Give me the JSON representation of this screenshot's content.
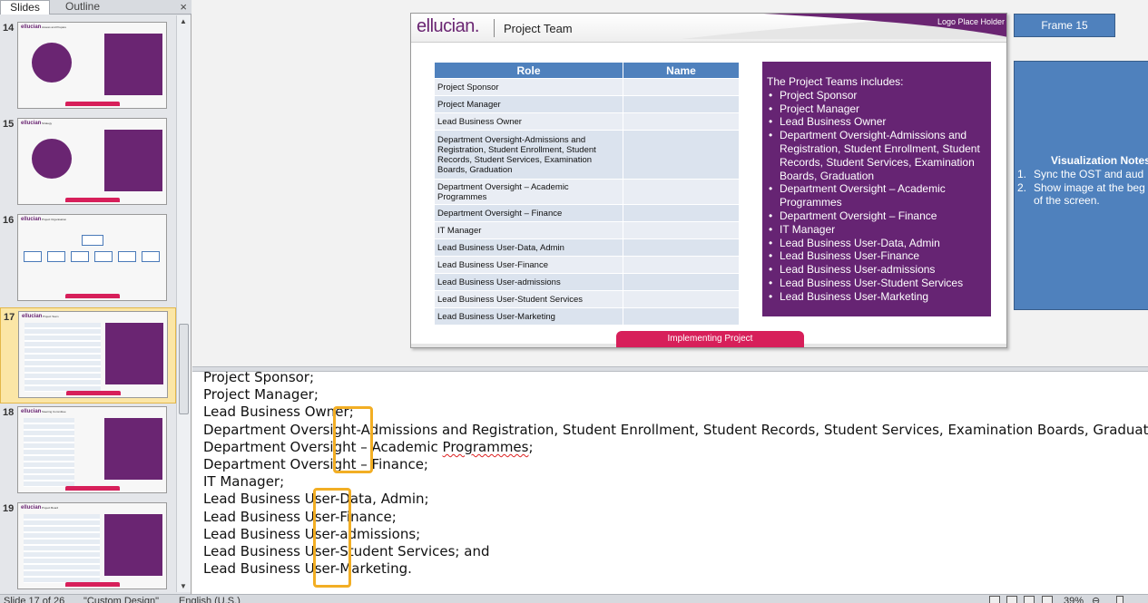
{
  "pane": {
    "tab_slides": "Slides",
    "tab_outline": "Outline",
    "close": "×"
  },
  "thumbnails": [
    {
      "num": "14",
      "kind": "circle",
      "selected": false
    },
    {
      "num": "15",
      "kind": "circle",
      "selected": false
    },
    {
      "num": "16",
      "kind": "org",
      "selected": false
    },
    {
      "num": "17",
      "kind": "table",
      "selected": true
    },
    {
      "num": "18",
      "kind": "table",
      "selected": false
    },
    {
      "num": "19",
      "kind": "table",
      "selected": false
    }
  ],
  "slide": {
    "logo": "ellucian.",
    "title": "Project Team",
    "logo_holder": "Logo Place Holder",
    "table_headers": {
      "role": "Role",
      "name": "Name"
    },
    "roles": [
      "Project Sponsor",
      "Project Manager",
      "Lead Business Owner",
      "Department Oversight-Admissions and Registration, Student Enrollment, Student Records, Student Services, Examination Boards, Graduation",
      "Department Oversight – Academic Programmes",
      "Department Oversight – Finance",
      "IT Manager",
      "Lead Business User-Data, Admin",
      "Lead Business User-Finance",
      "Lead Business User-admissions",
      "Lead Business User-Student Services",
      "Lead Business User-Marketing"
    ],
    "box_intro": "The Project Teams includes:",
    "box_items": [
      "Project Sponsor",
      "Project Manager",
      "Lead Business Owner",
      "Department Oversight-Admissions and Registration, Student Enrollment, Student Records, Student Services, Examination Boards, Graduation",
      "Department Oversight – Academic Programmes",
      "Department Oversight – Finance",
      "IT Manager",
      "Lead Business User-Data, Admin",
      "Lead Business User-Finance",
      "Lead Business User-admissions",
      "Lead Business User-Student Services",
      "Lead Business User-Marketing"
    ],
    "footer": "Implementing Project"
  },
  "frame_label": "Frame 15",
  "vis_notes": {
    "title": "Visualization Notes",
    "item1_num": "1.",
    "item1": "Sync the OST and aud",
    "item2_num": "2.",
    "item2": "Show image at the beg",
    "item2_cont": "of the screen."
  },
  "notes": {
    "l1": "Project Sponsor;",
    "l2": "Project Manager;",
    "l3": "Lead Business Owner;",
    "l4": "Department Oversight-Admissions and Registration, Student Enrollment, Student Records, Student Services, Examination Boards, Graduation;",
    "l5a": "Department Oversight – Academic ",
    "l5b": "Programmes",
    "l5c": ";",
    "l6": "Department Oversight – Finance;",
    "l7": "IT Manager;",
    "l8": "Lead Business User-Data, Admin;",
    "l9": "Lead Business User-Finance;",
    "l10": "Lead Business User-admissions;",
    "l11": "Lead Business User-Student Services; and",
    "l12": "Lead Business User-Marketing."
  },
  "status": {
    "slide_count": "Slide 17 of 26",
    "theme": "\"Custom Design\"",
    "language": "English (U.S.)",
    "zoom": "39%"
  }
}
